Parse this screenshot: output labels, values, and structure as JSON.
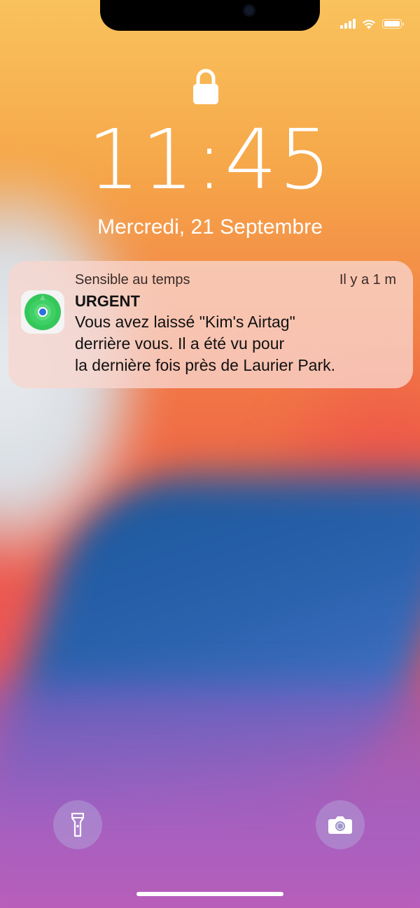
{
  "lock_screen": {
    "time": "11:45",
    "date": "Mercredi, 21 Septembre"
  },
  "notification": {
    "app_icon": "find-my-icon",
    "category": "Sensible au temps",
    "time_ago": "Il y a 1 m",
    "title": "URGENT",
    "body_lines": [
      "Vous avez laissé \"Kim's Airtag\"",
      "derrière vous. Il a été vu pour",
      "la dernière fois près de Laurier Park."
    ]
  },
  "quick_actions": {
    "left_icon": "flashlight-icon",
    "right_icon": "camera-icon"
  },
  "status_bar": {
    "signal_icon": "cellular-signal-icon",
    "wifi_icon": "wifi-icon",
    "battery_icon": "battery-icon",
    "battery_level": 1.0
  },
  "colors": {
    "notification_bg": "#f8d6ce",
    "find_my_green": "#34c759",
    "find_my_blue": "#2b6fe0"
  }
}
